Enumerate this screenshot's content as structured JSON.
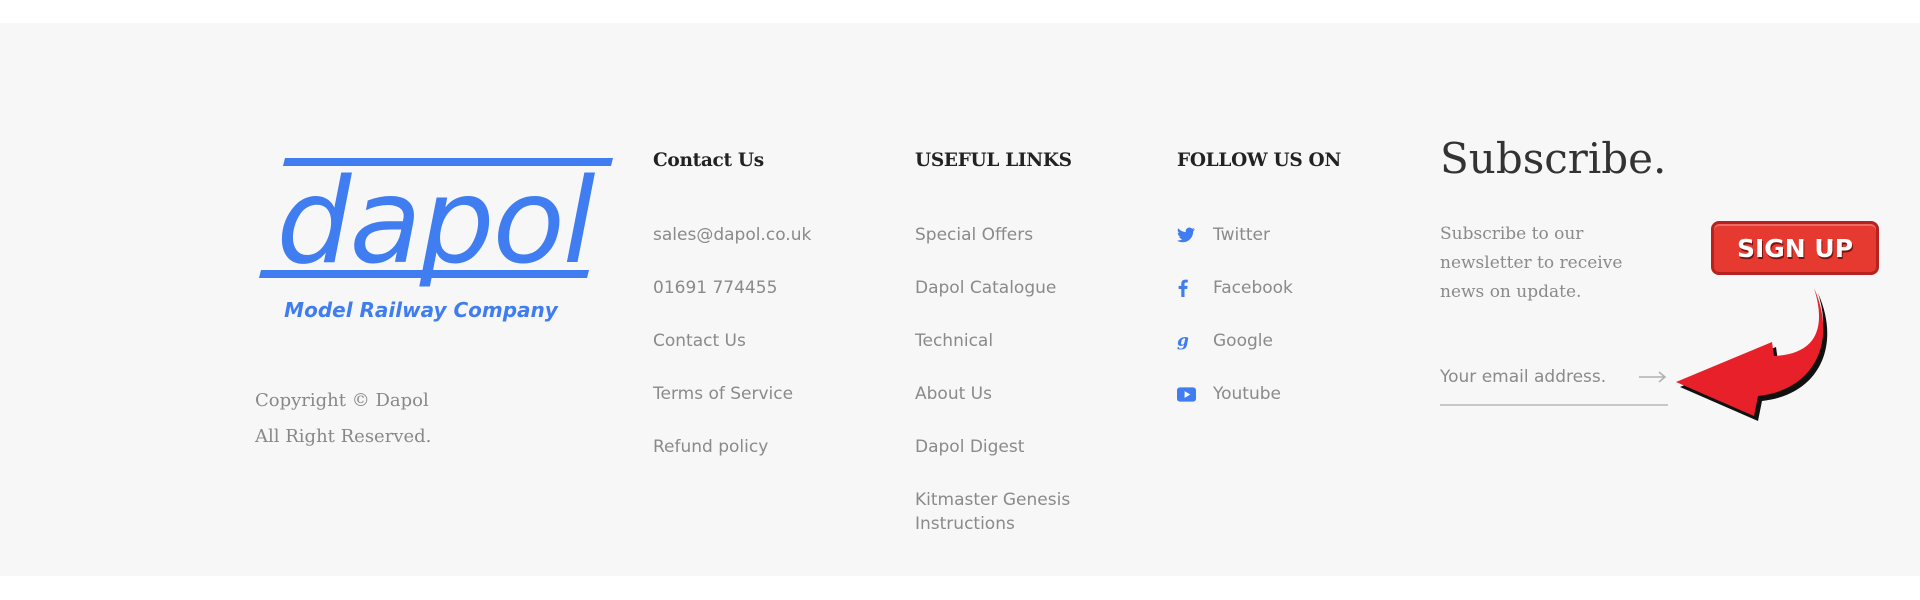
{
  "brand": {
    "logo_word": "dapol",
    "logo_tagline": "Model Railway Company",
    "logo_color": "#3f7df0",
    "copyright_line1": "Copyright © Dapol",
    "copyright_line2": "All Right Reserved."
  },
  "contact": {
    "title": "Contact Us",
    "items": [
      "sales@dapol.co.uk",
      "01691 774455",
      "Contact Us",
      "Terms of Service",
      "Refund policy"
    ]
  },
  "useful_links": {
    "title": "USEFUL LINKS",
    "items": [
      "Special Offers",
      "Dapol Catalogue",
      "Technical",
      "About Us",
      "Dapol Digest",
      "Kitmaster Genesis Instructions"
    ]
  },
  "follow": {
    "title": "FOLLOW US ON",
    "items": [
      {
        "label": "Twitter",
        "icon": "twitter-icon"
      },
      {
        "label": "Facebook",
        "icon": "facebook-icon"
      },
      {
        "label": "Google",
        "icon": "google-icon"
      },
      {
        "label": "Youtube",
        "icon": "youtube-icon"
      }
    ],
    "icon_color": "#3f7df0"
  },
  "subscribe": {
    "title": "Subscribe.",
    "text": "Subscribe to our newsletter to receive news on update.",
    "email_placeholder": "Your email address.",
    "button_label": "SIGN UP",
    "button_color": "#e63a30"
  }
}
